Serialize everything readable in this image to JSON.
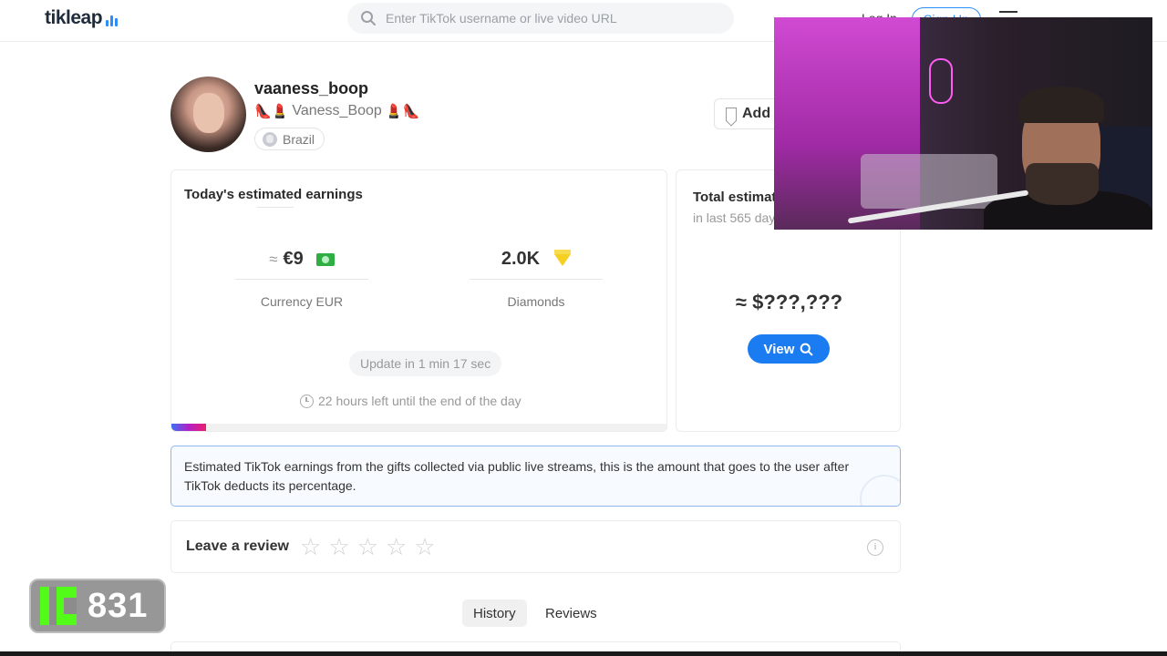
{
  "header": {
    "logo_text": "tikleap",
    "search_placeholder": "Enter TikTok username or live video URL",
    "login_label": "Log In",
    "signup_label": "Sign Up"
  },
  "profile": {
    "username": "vaaness_boop",
    "display_name": "Vaness_Boop",
    "display_emoji_left": "👠💄",
    "display_emoji_right": "💄👠",
    "country": "Brazil",
    "add_label": "Add"
  },
  "today": {
    "title": "Today's estimated earnings",
    "currency_approx": "≈",
    "currency_value": "€9",
    "currency_label": "Currency EUR",
    "diamonds_value": "2.0K",
    "diamonds_label": "Diamonds",
    "update_text": "Update in 1 min 17 sec",
    "time_left_text": "22 hours left until the end of the day",
    "day_progress": 0.07
  },
  "total": {
    "title": "Total estimated earnings",
    "subtitle": "in last 565 days",
    "value": "≈ $???,???",
    "view_label": "View"
  },
  "info": {
    "text": "Estimated TikTok earnings from the gifts collected via public live streams, this is the amount that goes to the user after TikTok deducts its percentage."
  },
  "review": {
    "label": "Leave a review",
    "stars": 5,
    "rating": 0,
    "info_symbol": "i"
  },
  "tabs": {
    "history_label": "History",
    "reviews_label": "Reviews",
    "active": "History"
  },
  "overlay": {
    "kick_count": "831",
    "kick_color": "#53fc18"
  },
  "colors": {
    "accent": "#1b7cf2",
    "progress_gradient": [
      "#3f6ff6",
      "#b11fc5",
      "#f01e6f"
    ]
  }
}
